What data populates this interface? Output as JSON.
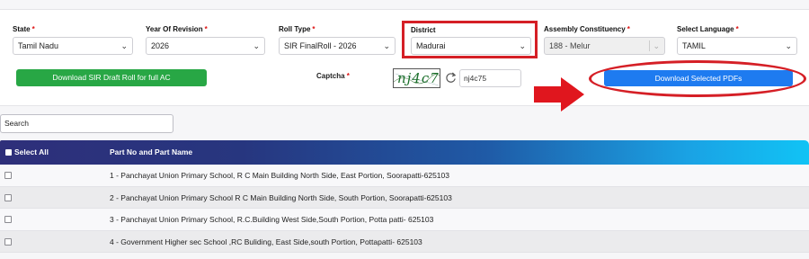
{
  "filters": {
    "state": {
      "label": "State",
      "value": "Tamil Nadu"
    },
    "year": {
      "label": "Year Of Revision",
      "value": "2026"
    },
    "roll_type": {
      "label": "Roll Type",
      "value": "SIR FinalRoll - 2026"
    },
    "district": {
      "label": "District",
      "value": "Madurai"
    },
    "assembly": {
      "label": "Assembly Constituency",
      "value": "188 - Melur"
    },
    "language": {
      "label": "Select Language",
      "value": "TAMIL"
    }
  },
  "actions": {
    "download_full_label": "Download SIR Draft Roll for full AC",
    "download_selected_label": "Download Selected PDFs"
  },
  "captcha": {
    "label": "Captcha",
    "image_text": "nj4c75",
    "input_value": "nj4c75"
  },
  "search": {
    "placeholder": "Search"
  },
  "table": {
    "headers": {
      "select_all": "Select All",
      "part": "Part No and Part Name"
    },
    "rows": [
      "1 - Panchayat Union Primary School, R C Main Building North Side, East Portion, Soorapatti-625103",
      "2 - Panchayat Union Primary School R C Main Building North Side, South Portion, Soorapatti-625103",
      "3 - Panchayat Union Primary School, R.C.Building West Side,South Portion, Potta patti- 625103",
      "4 - Government Higher sec School ,RC Buliding, East Side,south Portion, Pottapatti- 625103"
    ]
  },
  "colors": {
    "annotation": "#d51f26",
    "green_button": "#28a745",
    "blue_button": "#1e7bf0"
  }
}
